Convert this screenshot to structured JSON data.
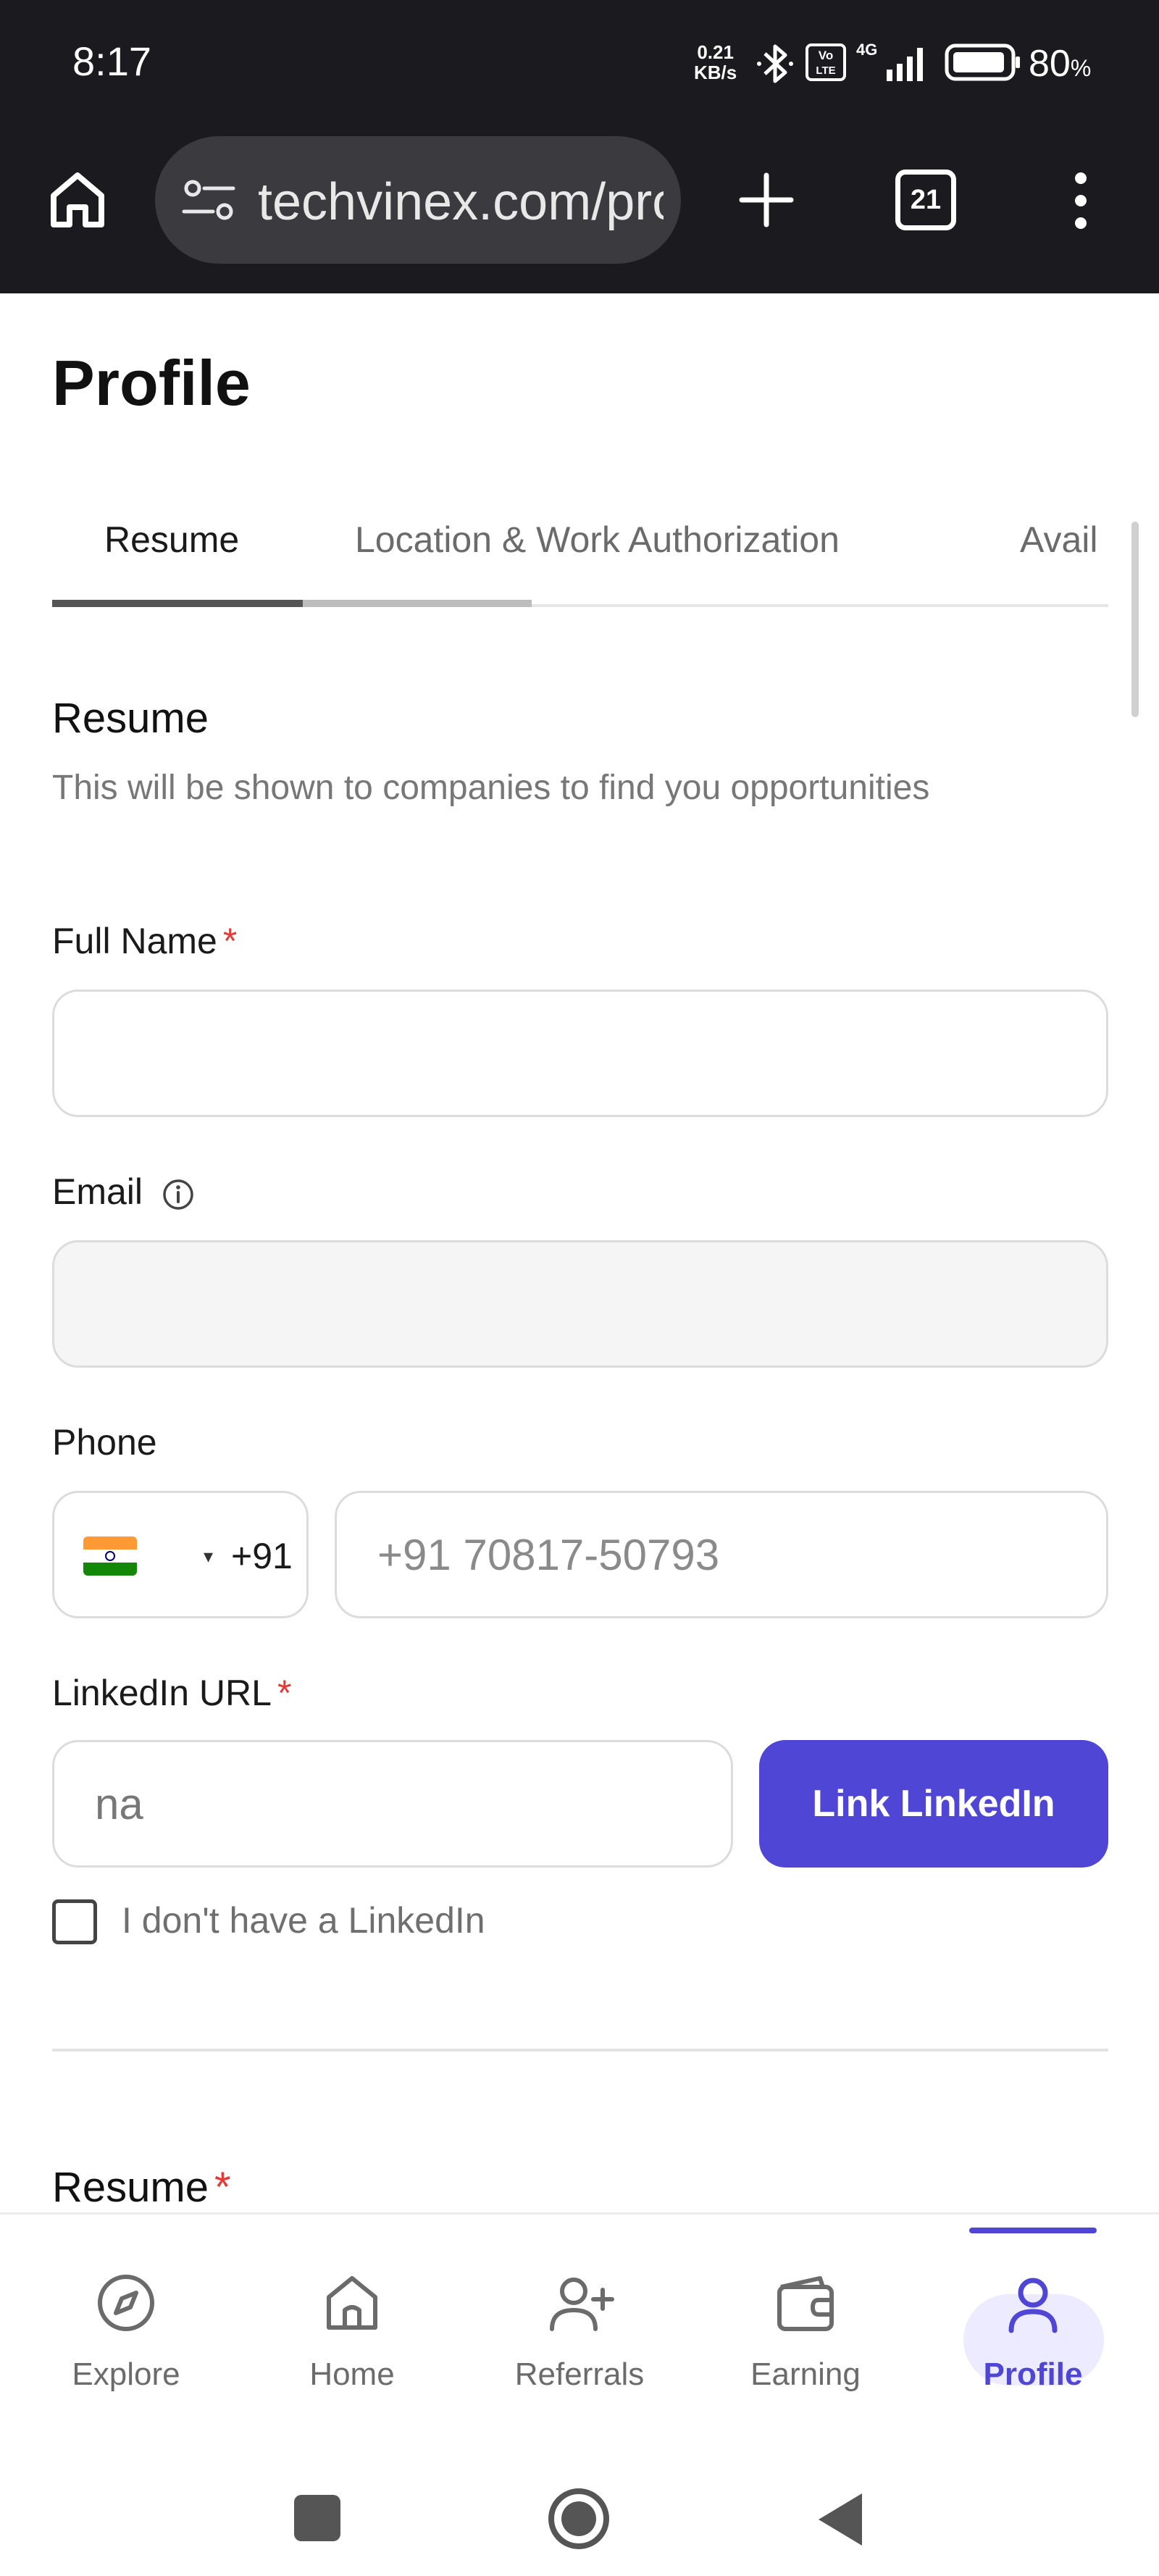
{
  "status_bar": {
    "time": "8:17",
    "net_speed_value": "0.21",
    "net_speed_unit": "KB/s",
    "network_type": "4G",
    "volte_label": "Vo LTE",
    "battery_percent": "80",
    "battery_symbol": "%"
  },
  "browser": {
    "url": "techvinex.com/profile",
    "tab_count": "21"
  },
  "page": {
    "title": "Profile",
    "tabs": [
      {
        "label": "Resume",
        "active": true
      },
      {
        "label": "Location & Work Authorization",
        "active": false
      },
      {
        "label": "Avail",
        "active": false
      }
    ]
  },
  "resume_section": {
    "title": "Resume",
    "subtitle": "This will be shown to companies to find you opportunities"
  },
  "form": {
    "full_name": {
      "label": "Full Name",
      "required_mark": "*",
      "value": ""
    },
    "email": {
      "label": "Email",
      "value": ""
    },
    "phone": {
      "label": "Phone",
      "country_code": "+91",
      "country": "India",
      "caret": "▾",
      "placeholder": "+91 70817-50793"
    },
    "linkedin": {
      "label": "LinkedIn URL",
      "required_mark": "*",
      "value": "na",
      "button_label": "Link LinkedIn",
      "no_linkedin_label": "I don't have a LinkedIn",
      "no_linkedin_checked": false
    },
    "resume_upload": {
      "label": "Resume",
      "required_mark": "*"
    }
  },
  "bottom_nav": {
    "items": [
      {
        "label": "Explore",
        "icon": "compass-icon"
      },
      {
        "label": "Home",
        "icon": "home-icon"
      },
      {
        "label": "Referrals",
        "icon": "add-user-icon"
      },
      {
        "label": "Earning",
        "icon": "wallet-icon"
      },
      {
        "label": "Profile",
        "icon": "user-icon",
        "active": true
      }
    ]
  },
  "colors": {
    "accent": "#4f46d6",
    "required": "#e53935",
    "topbar": "#1b1b1f"
  }
}
